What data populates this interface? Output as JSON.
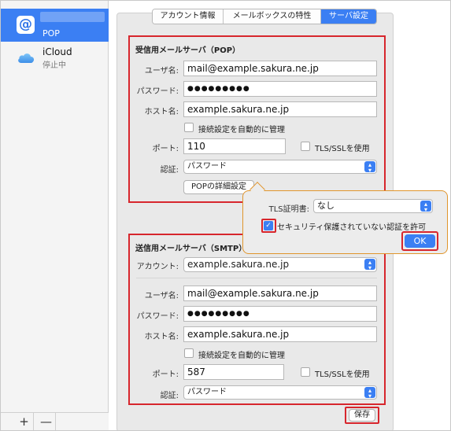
{
  "sidebar": {
    "accounts": [
      {
        "icon": "at-sign-icon",
        "name": "",
        "type": "POP",
        "selected": true
      },
      {
        "icon": "cloud-icon",
        "name": "iCloud",
        "status": "停止中",
        "selected": false
      }
    ],
    "add_label": "+",
    "remove_label": "—"
  },
  "tabs": [
    {
      "label": "アカウント情報",
      "active": false
    },
    {
      "label": "メールボックスの特性",
      "active": false
    },
    {
      "label": "サーバ設定",
      "active": true
    }
  ],
  "incoming": {
    "title": "受信用メールサーバ（POP）",
    "username_label": "ユーザ名:",
    "username": "mail@example.sakura.ne.jp",
    "password_label": "パスワード:",
    "password": "●●●●●●●●●",
    "host_label": "ホスト名:",
    "host": "example.sakura.ne.jp",
    "auto_manage_label": "接続設定を自動的に管理",
    "port_label": "ポート:",
    "port": "110",
    "tls_label": "TLS/SSLを使用",
    "auth_label": "認証:",
    "auth": "パスワード",
    "advanced_button": "POPの詳細設定"
  },
  "popover": {
    "tls_cert_label": "TLS証明書:",
    "tls_cert": "なし",
    "allow_insecure_label": "セキュリティ保護されていない認証を許可",
    "allow_insecure_checked": true,
    "ok_label": "OK"
  },
  "outgoing": {
    "title": "送信用メールサーバ（SMTP）",
    "account_label": "アカウント:",
    "account": "example.sakura.ne.jp",
    "username_label": "ユーザ名:",
    "username": "mail@example.sakura.ne.jp",
    "password_label": "パスワード:",
    "password": "●●●●●●●●●",
    "host_label": "ホスト名:",
    "host": "example.sakura.ne.jp",
    "auto_manage_label": "接続設定を自動的に管理",
    "port_label": "ポート:",
    "port": "587",
    "tls_label": "TLS/SSLを使用",
    "auth_label": "認証:",
    "auth": "パスワード"
  },
  "save_label": "保存",
  "colors": {
    "accent": "#3b7ff3",
    "highlight": "#d7262d",
    "popover_border": "#e0952c"
  }
}
